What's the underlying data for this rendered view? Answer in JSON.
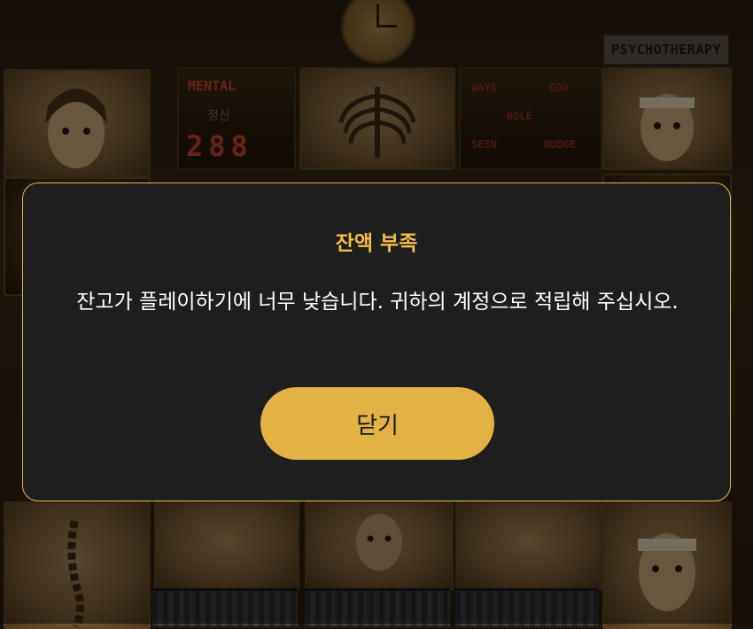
{
  "background": {
    "sign_text": "PSYCHOTHERAPY",
    "mental_panel": {
      "title": "MENTAL",
      "subtitle": "정신",
      "value": "288"
    },
    "words": [
      "WAYS",
      "GOD",
      "HOLE",
      "SEEN",
      "NUDGE"
    ]
  },
  "modal": {
    "title": "잔액 부족",
    "message": "잔고가 플레이하기에 너무 낮습니다. 귀하의 계정으로 적립해 주십시오.",
    "close_label": "닫기"
  },
  "colors": {
    "accent": "#e3b245",
    "title": "#f2bd45",
    "modal_bg": "#1e1e1e"
  }
}
